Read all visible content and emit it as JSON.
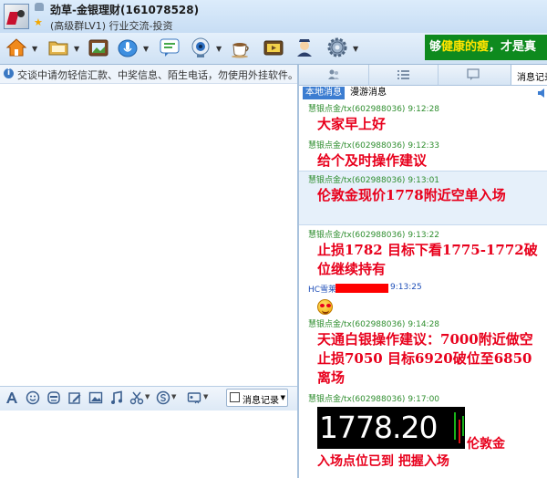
{
  "window": {
    "title": "劲草-金银理财(161078528)",
    "subtitle": "(高级群LV1) 行业交流-投资"
  },
  "toolbar": {
    "ad_part1": "够",
    "ad_highlight": "健康的瘦",
    "ad_part2": "，才是真"
  },
  "notice": "交谈中请勿轻信汇款、中奖信息、陌生电话，勿使用外挂软件。",
  "input_toolbar": {
    "message_record_label": "消息记录"
  },
  "right_panel": {
    "active_tab": "消息记录",
    "subtabs": [
      "本地消息",
      "漫游消息"
    ],
    "messages": [
      {
        "sender": "慧银点金/tx(602988036)",
        "time": "9:12:28",
        "body": "大家早上好"
      },
      {
        "sender": "慧银点金/tx(602988036)",
        "time": "9:12:33",
        "body": "给个及时操作建议"
      },
      {
        "sender": "慧银点金/tx(602988036)",
        "time": "9:13:01",
        "body": "伦敦金现价1778附近空单入场"
      },
      {
        "sender": "慧银点金/tx(602988036)",
        "time": "9:13:22",
        "body": "止损1782   目标下看1775-1772破位继续持有"
      },
      {
        "sender": "HC雪莱",
        "time": "9:13:25",
        "body": ""
      },
      {
        "sender": "慧银点金/tx(602988036)",
        "time": "9:14:28",
        "body": "天通白银操作建议：7000附近做空 止损7050 目标6920破位至6850离场"
      },
      {
        "sender": "慧银点金/tx(602988036)",
        "time": "9:17:00",
        "price": "1778.20",
        "after_text": "伦敦金",
        "body": "入场点位已到   把握入场"
      }
    ]
  }
}
